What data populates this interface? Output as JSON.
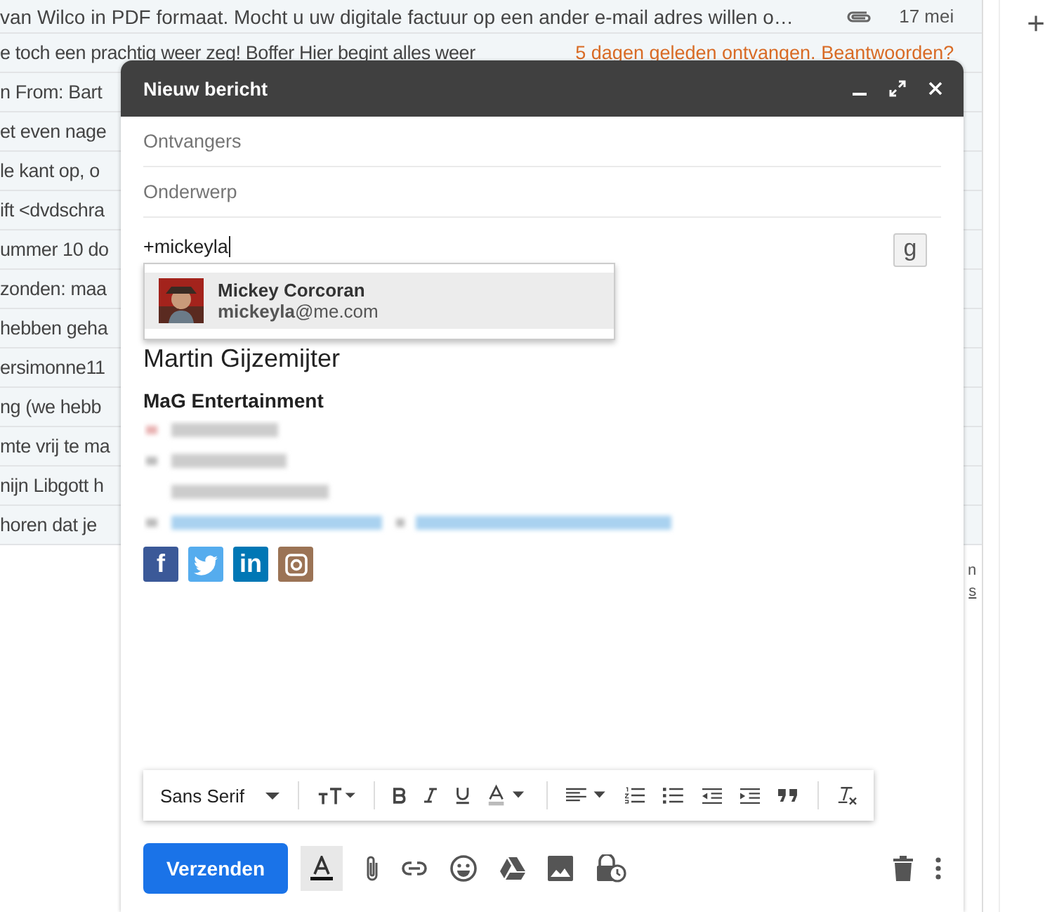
{
  "inbox": {
    "rows": [
      {
        "snippet": "van Wilco in PDF formaat. Mocht u uw digitale factuur op een ander e-mail adres willen o…",
        "attachment": true,
        "date": "17 mei"
      },
      {
        "snippet": "e toch een prachtig weer zeg! Boffer Hier begint alles weer",
        "notice": "5 dagen geleden ontvangen. Beantwoorden?"
      },
      {
        "snippet": "n From: Bart"
      },
      {
        "snippet": "et even nage"
      },
      {
        "snippet": "le kant op, o"
      },
      {
        "snippet": "ift <dvdschra"
      },
      {
        "snippet": "ummer 10 do"
      },
      {
        "snippet": "zonden: maa"
      },
      {
        "snippet": "hebben geha"
      },
      {
        "snippet": "ersimonne11"
      },
      {
        "snippet": "ng (we hebb"
      },
      {
        "snippet": "mte vrij te ma"
      },
      {
        "snippet": "nijn Libgott h"
      },
      {
        "snippet": "horen dat je"
      }
    ],
    "footer_fragments": [
      {
        "text": "n",
        "link": false
      },
      {
        "text": "s",
        "link": true
      }
    ]
  },
  "side_panel": {
    "add_label": "+"
  },
  "compose": {
    "title": "Nieuw bericht",
    "recipients_placeholder": "Ontvangers",
    "subject_placeholder": "Onderwerp",
    "body_typed": "+mickeyla",
    "g_button": "g",
    "suggestion": {
      "name": "Mickey Corcoran",
      "email": "**mickeyla**@me.com",
      "selected": true
    },
    "signature": {
      "name": "Martin Gijzemijter",
      "company": "MaG Entertainment"
    },
    "social": [
      {
        "kind": "facebook",
        "label": "f"
      },
      {
        "kind": "twitter"
      },
      {
        "kind": "linkedin",
        "label": "in"
      },
      {
        "kind": "instagram"
      }
    ],
    "toolbar": {
      "font": "Sans Serif"
    },
    "send_label": "Verzenden"
  }
}
